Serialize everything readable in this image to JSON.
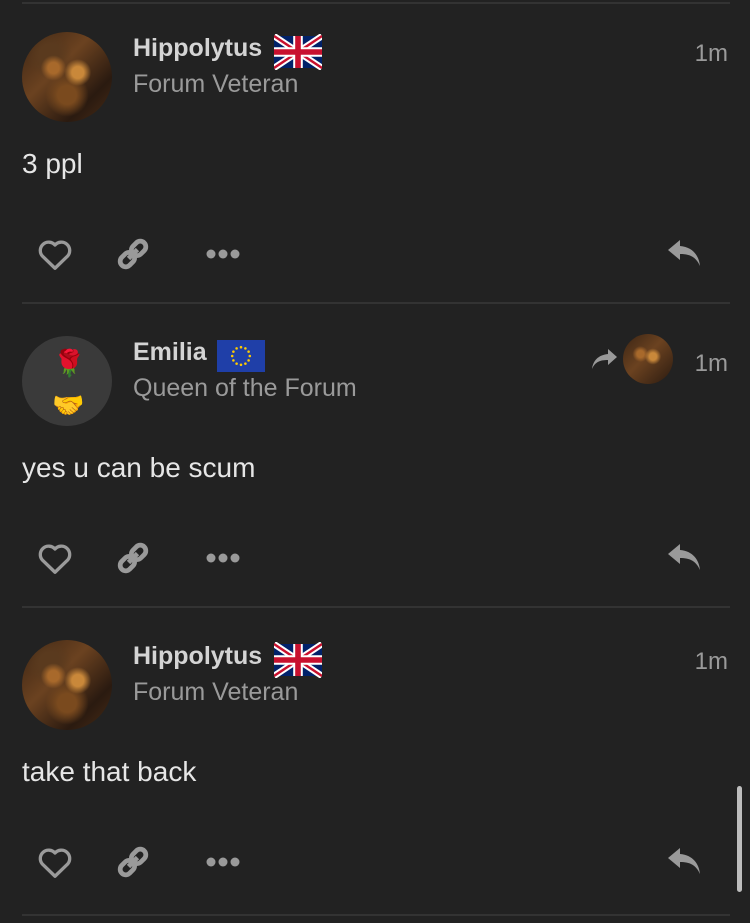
{
  "posts": [
    {
      "username": "Hippolytus",
      "title": "Forum Veteran",
      "time": "1m",
      "content": "3 ppl",
      "flag": "uk-flag-icon",
      "avatar": "painting"
    },
    {
      "username": "Emilia",
      "title": "Queen of the Forum",
      "time": "1m",
      "content": "yes u can be scum",
      "flag": "eu-flag-icon",
      "avatar": "rose-handshake"
    },
    {
      "username": "Hippolytus",
      "title": "Forum Veteran",
      "time": "1m",
      "content": "take that back",
      "flag": "uk-flag-icon",
      "avatar": "painting"
    }
  ],
  "icons": {
    "like": "heart-icon",
    "link": "link-icon",
    "more": "ellipsis-icon",
    "reply": "reply-icon",
    "reply_to": "reply-to-arrow-icon"
  },
  "colors": {
    "background": "#222222",
    "text": "#dddddd",
    "muted": "#9a9a9a",
    "icon": "#9a9a9a"
  }
}
